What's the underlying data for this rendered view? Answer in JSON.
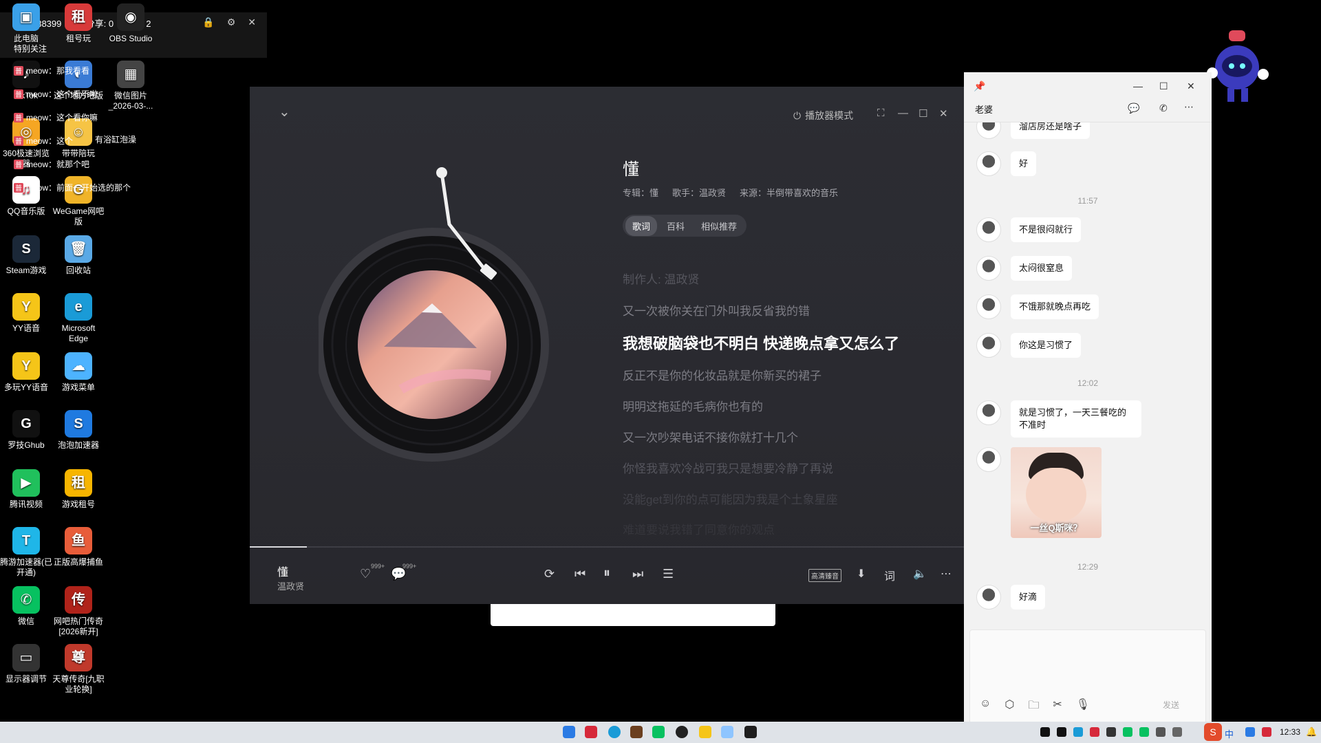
{
  "live": {
    "stat_heat": "热度: 38399",
    "stat_zero": "0",
    "stat_share": "分享: 0",
    "stat_viewers": "观众: 2",
    "special_follow": "特别关注",
    "danmu": [
      "meow：那我看看",
      "meow：这个看不啦",
      "meow：这个看你嘛",
      "meow：这个",
      "meow：就那个吧",
      "meow：前面一开始选的那个"
    ],
    "tag_label": "普"
  },
  "desktop": {
    "icons": [
      {
        "label": "此电脑",
        "color": "#3aa0e8",
        "glyph": "▣"
      },
      {
        "label": "租号玩",
        "color": "#d83a3a",
        "glyph": "租"
      },
      {
        "label": "OBS Studio",
        "color": "#222222",
        "glyph": "◉"
      },
      {
        "label": "TikTok",
        "color": "#111111",
        "glyph": "♪"
      },
      {
        "label": "这个地方吧版",
        "color": "#3a7bd5",
        "glyph": "◐"
      },
      {
        "label": "微信图片_2026-03-...",
        "color": "#444444",
        "glyph": "▦"
      },
      {
        "label": "360极速浏览器",
        "color": "#f5a623",
        "glyph": "◎"
      },
      {
        "label": "带带陪玩",
        "color": "#f6c445",
        "glyph": "☺"
      },
      {
        "label": "有浴缸泡澡",
        "color": "",
        "glyph": ""
      },
      {
        "label": "QQ音乐版",
        "color": "#ffffff",
        "glyph": "♫"
      },
      {
        "label": "WeGame网吧版",
        "color": "#f0b429",
        "glyph": "G"
      },
      {
        "label": "Steam游戏",
        "color": "#1b2838",
        "glyph": "S"
      },
      {
        "label": "回收站",
        "color": "#5aa9e6",
        "glyph": "🗑"
      },
      {
        "label": "YY语音",
        "color": "#f5c518",
        "glyph": "Y"
      },
      {
        "label": "Microsoft Edge",
        "color": "#1a9bd7",
        "glyph": "e"
      },
      {
        "label": "多玩YY语音",
        "color": "#f5c518",
        "glyph": "Y"
      },
      {
        "label": "游戏菜单",
        "color": "#4db3ff",
        "glyph": "☁"
      },
      {
        "label": "罗技Ghub",
        "color": "#111111",
        "glyph": "G"
      },
      {
        "label": "泡泡加速器",
        "color": "#1f7ae0",
        "glyph": "S"
      },
      {
        "label": "腾讯视频",
        "color": "#20c05c",
        "glyph": "▶"
      },
      {
        "label": "游戏租号",
        "color": "#f7b500",
        "glyph": "租"
      },
      {
        "label": "腾游加速器(已开通)",
        "color": "#1fb6e8",
        "glyph": "T"
      },
      {
        "label": "正版高爆捕鱼",
        "color": "#e85d3a",
        "glyph": "鱼"
      },
      {
        "label": "微信",
        "color": "#07c160",
        "glyph": "✆"
      },
      {
        "label": "网吧热门传奇[2026新开]",
        "color": "#b0231a",
        "glyph": "传"
      },
      {
        "label": "显示器调节",
        "color": "#333333",
        "glyph": "▭"
      },
      {
        "label": "天尊传奇[九职业轮换]",
        "color": "#c0392b",
        "glyph": "尊"
      }
    ]
  },
  "player": {
    "mode_label": "播放器模式",
    "title": "懂",
    "album_label": "专辑：懂",
    "singer_label": "歌手：温政贤",
    "source_label": "来源：半倒带喜欢的音乐",
    "tabs": [
      "歌词",
      "百科",
      "相似推荐"
    ],
    "lyrics": [
      "制作人: 温政贤",
      "又一次被你关在门外叫我反省我的错",
      "我想破脑袋也不明白 快递晚点拿又怎么了",
      "反正不是你的化妆品就是你新买的裙子",
      "明明这拖延的毛病你也有的",
      "又一次吵架电话不接你就打十几个",
      "你怪我喜欢冷战可我只是想要冷静了再说",
      "没能get到你的点可能因为我是个土象星座",
      "难道要说我错了同意你的观点"
    ],
    "now_title": "懂",
    "now_artist": "温政贤",
    "like_count": "999+",
    "comment_count": "999+",
    "quality_label": "高清臻音",
    "progress": 0.08
  },
  "chat": {
    "contact": "老婆",
    "messages": [
      {
        "type": "text",
        "text": "溜店房还是啥子"
      },
      {
        "type": "text",
        "text": "好"
      },
      {
        "type": "time",
        "text": "11:57"
      },
      {
        "type": "text",
        "text": "不是很闷就行"
      },
      {
        "type": "text",
        "text": "太闷很窒息"
      },
      {
        "type": "text",
        "text": "不饿那就晚点再吃"
      },
      {
        "type": "text",
        "text": "你这是习惯了"
      },
      {
        "type": "time",
        "text": "12:02"
      },
      {
        "type": "text",
        "text": "就是习惯了，一天三餐吃的不准时"
      },
      {
        "type": "image",
        "text": "一丝Q斯咪？"
      },
      {
        "type": "time",
        "text": "12:29"
      },
      {
        "type": "text",
        "text": "好滴"
      }
    ],
    "send_label": "发送"
  },
  "taskbar": {
    "clock": "12:33",
    "ime_label": "中"
  }
}
